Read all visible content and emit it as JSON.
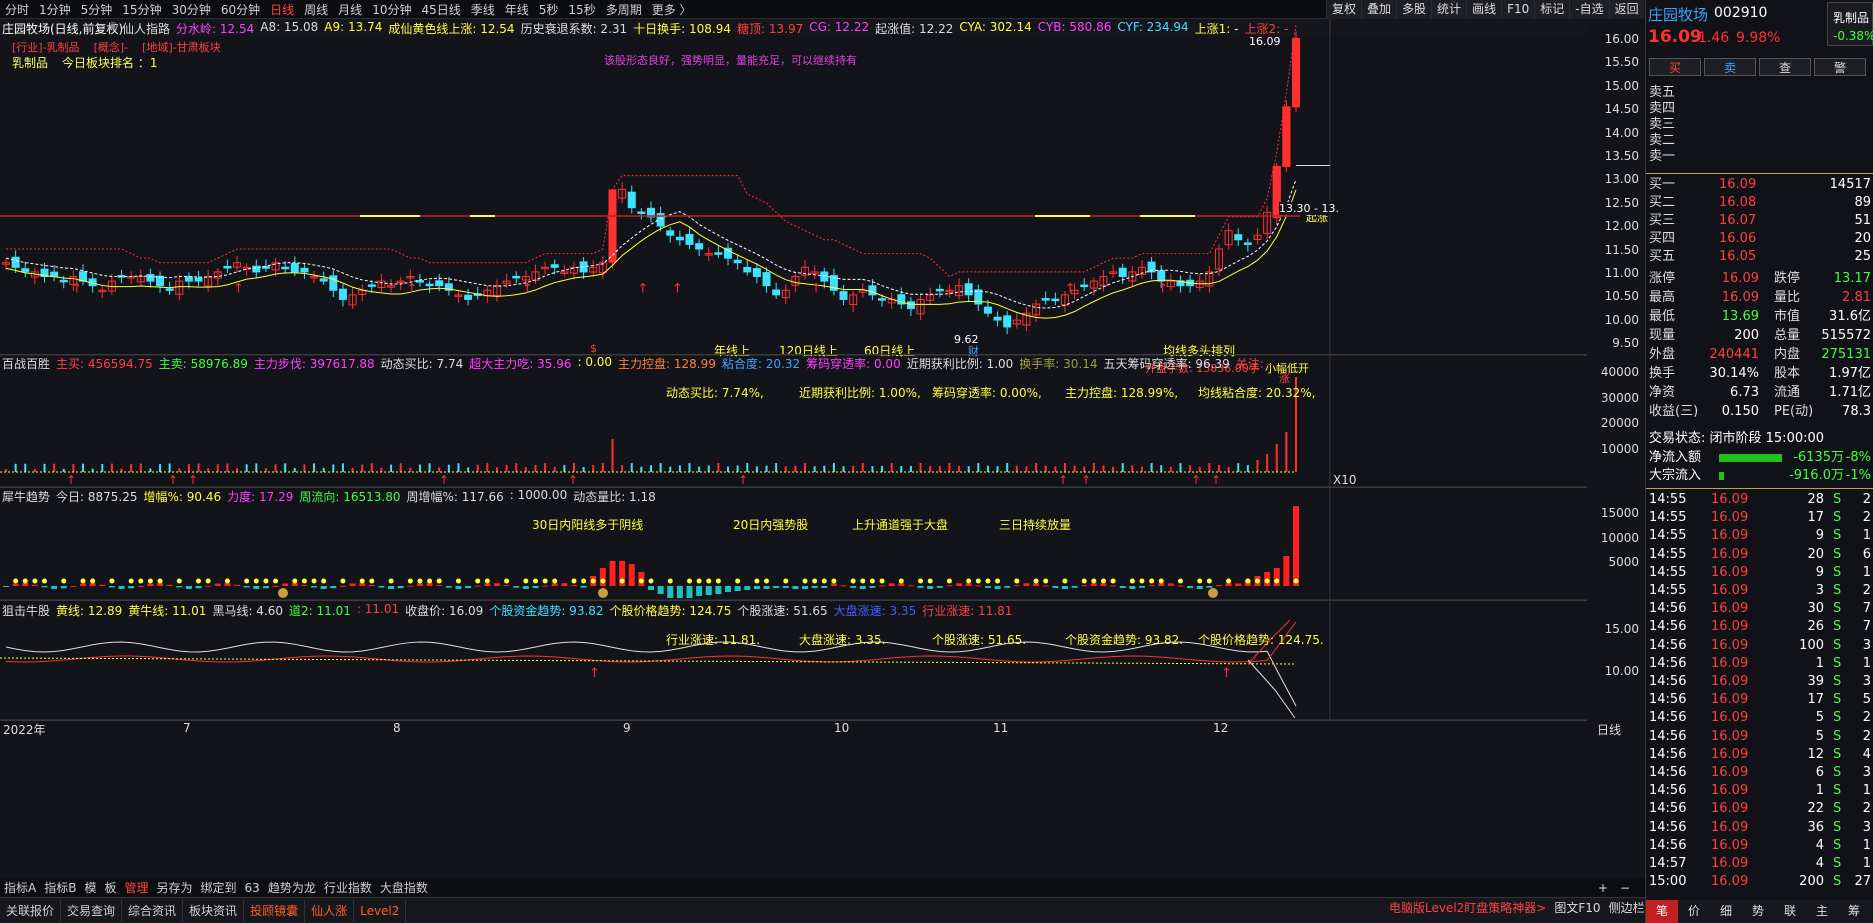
{
  "timeframes": [
    "分时",
    "1分钟",
    "5分钟",
    "15分钟",
    "30分钟",
    "60分钟",
    "日线",
    "周线",
    "月线",
    "10分钟",
    "45日线",
    "季线",
    "年线",
    "5秒",
    "15秒",
    "多周期",
    "更多 〉"
  ],
  "active_timeframe": "日线",
  "right_buttons": [
    "复权",
    "叠加",
    "多股",
    "统计",
    "画线",
    "F10",
    "标记",
    "-自选",
    "返回"
  ],
  "stock": {
    "name": "庄园牧场",
    "code": "002910",
    "price": "16.09",
    "change": "1.46",
    "pct": "9.98%",
    "sector": "乳制品",
    "sector_pct": "-0.38%"
  },
  "trade_buttons": [
    "买",
    "卖",
    "查",
    "警"
  ],
  "sell_levels": [
    "卖五",
    "卖四",
    "卖三",
    "卖二",
    "卖一"
  ],
  "buy_levels": [
    {
      "label": "买一",
      "price": "16.09",
      "vol": "14517"
    },
    {
      "label": "买二",
      "price": "16.08",
      "vol": "89"
    },
    {
      "label": "买三",
      "price": "16.07",
      "vol": "51"
    },
    {
      "label": "买四",
      "price": "16.06",
      "vol": "20"
    },
    {
      "label": "买五",
      "price": "16.05",
      "vol": "25"
    }
  ],
  "stats": [
    {
      "l1": "涨停",
      "v1": "16.09",
      "l2": "跌停",
      "v2": "13.17"
    },
    {
      "l1": "最高",
      "v1": "16.09",
      "l2": "量比",
      "v2": "2.81"
    },
    {
      "l1": "最低",
      "v1": "13.69",
      "l2": "市值",
      "v2": "31.6亿"
    },
    {
      "l1": "现量",
      "v1": "200",
      "l2": "总量",
      "v2": "515572"
    },
    {
      "l1": "外盘",
      "v1": "240441",
      "l2": "内盘",
      "v2": "275131"
    },
    {
      "l1": "换手",
      "v1": "30.14%",
      "l2": "股本",
      "v2": "1.97亿"
    },
    {
      "l1": "净资",
      "v1": "6.73",
      "l2": "流通",
      "v2": "1.71亿"
    },
    {
      "l1": "收益(三)",
      "v1": "0.150",
      "l2": "PE(动)",
      "v2": "78.3"
    }
  ],
  "trade_status": "交易状态: 闭市阶段 15:00:00",
  "flows": [
    {
      "label": "净流入额",
      "value": "-6135万",
      "pct": "-8%",
      "bar": 0.7
    },
    {
      "label": "大宗流入",
      "value": "-916.0万",
      "pct": "-1%",
      "bar": 0.05
    }
  ],
  "ticks": [
    [
      "14:55",
      "16.09",
      "28",
      "S",
      "2"
    ],
    [
      "14:55",
      "16.09",
      "17",
      "S",
      "2"
    ],
    [
      "14:55",
      "16.09",
      "9",
      "S",
      "1"
    ],
    [
      "14:55",
      "16.09",
      "20",
      "S",
      "6"
    ],
    [
      "14:55",
      "16.09",
      "9",
      "S",
      "1"
    ],
    [
      "14:55",
      "16.09",
      "3",
      "S",
      "2"
    ],
    [
      "14:56",
      "16.09",
      "30",
      "S",
      "7"
    ],
    [
      "14:56",
      "16.09",
      "26",
      "S",
      "7"
    ],
    [
      "14:56",
      "16.09",
      "100",
      "S",
      "3"
    ],
    [
      "14:56",
      "16.09",
      "1",
      "S",
      "1"
    ],
    [
      "14:56",
      "16.09",
      "39",
      "S",
      "3"
    ],
    [
      "14:56",
      "16.09",
      "17",
      "S",
      "5"
    ],
    [
      "14:56",
      "16.09",
      "5",
      "S",
      "2"
    ],
    [
      "14:56",
      "16.09",
      "5",
      "S",
      "2"
    ],
    [
      "14:56",
      "16.09",
      "12",
      "S",
      "4"
    ],
    [
      "14:56",
      "16.09",
      "6",
      "S",
      "3"
    ],
    [
      "14:56",
      "16.09",
      "1",
      "S",
      "1"
    ],
    [
      "14:56",
      "16.09",
      "22",
      "S",
      "2"
    ],
    [
      "14:56",
      "16.09",
      "36",
      "S",
      "3"
    ],
    [
      "14:56",
      "16.09",
      "4",
      "S",
      "1"
    ],
    [
      "14:57",
      "16.09",
      "4",
      "S",
      "1"
    ],
    [
      "15:00",
      "16.09",
      "200",
      "S",
      "27"
    ]
  ],
  "right_bottom_tabs": [
    "笔",
    "价",
    "细",
    "势",
    "联",
    "主",
    "筹"
  ],
  "main_chart": {
    "title": "庄园牧场(日线,前复权)",
    "indicator_line": [
      {
        "t": "仙人指路",
        "c": "#dddddd"
      },
      {
        "t": "分水岭: 12.54",
        "c": "#ff40ff"
      },
      {
        "t": "A8: 15.08",
        "c": "#dddddd"
      },
      {
        "t": "A9: 13.74",
        "c": "#ffff40"
      },
      {
        "t": "成仙黄色线上涨: 12.54",
        "c": "#ffff40"
      },
      {
        "t": "历史衰退系数: 2.31",
        "c": "#dddddd"
      },
      {
        "t": "十日换手: 108.94",
        "c": "#ffff40"
      },
      {
        "t": "糖顶: 13.97",
        "c": "#ff4040"
      },
      {
        "t": "CG: 12.22",
        "c": "#ff40ff"
      },
      {
        "t": "起涨值: 12.22",
        "c": "#dddddd"
      },
      {
        "t": "CYA: 302.14",
        "c": "#ffff40"
      },
      {
        "t": "CYB: 580.86",
        "c": "#ff40ff"
      },
      {
        "t": "CYF: 234.94",
        "c": "#40e0ff"
      },
      {
        "t": "上涨1: -",
        "c": "#ffff40"
      },
      {
        "t": "上涨2: -",
        "c": "#ff4040"
      }
    ],
    "tags": [
      "[行业]-乳制品",
      "[概念]-",
      "[地域]-甘肃板块"
    ],
    "sector_name": "乳制品",
    "sector_rank": "今日板块排名 ：1",
    "comment": "该股形态良好，强势明显，量能充足，可以继续持有",
    "annotations": [
      "年线上",
      "120日线上",
      "60日线上",
      "均线多头排列",
      "开盘手数: 15836.00手",
      "小幅低开",
      "起涨",
      "13.30 - 13.",
      "16.09",
      "9.62",
      "财",
      "涨",
      "$"
    ],
    "y_ticks": [
      "16.00",
      "15.50",
      "15.00",
      "14.50",
      "14.00",
      "13.50",
      "13.00",
      "12.50",
      "12.00",
      "11.50",
      "11.00",
      "10.50",
      "10.00",
      "9.50"
    ]
  },
  "panel2": {
    "labels": [
      {
        "t": "百战百胜",
        "c": "#dddddd"
      },
      {
        "t": "主买: 456594.75",
        "c": "#ff4040"
      },
      {
        "t": "主卖: 58976.89",
        "c": "#40ff40"
      },
      {
        "t": "主力步伐: 397617.88",
        "c": "#ff40ff"
      },
      {
        "t": "动态买比: 7.74",
        "c": "#dddddd"
      },
      {
        "t": "超大主力吃: 35.96",
        "c": "#ff40ff"
      },
      {
        "t": ": 0.00",
        "c": "#ffff40"
      },
      {
        "t": "主力控盘: 128.99",
        "c": "#ff8040"
      },
      {
        "t": "粘合度: 20.32",
        "c": "#40a0ff"
      },
      {
        "t": "筹码穿透率: 0.00",
        "c": "#ff40ff"
      },
      {
        "t": "近期获利比例: 1.00",
        "c": "#dddddd"
      },
      {
        "t": "换手率: 30.14",
        "c": "#a0a040"
      },
      {
        "t": "五天筹码穿透率: 96.39",
        "c": "#dddddd"
      },
      {
        "t": "关注: -",
        "c": "#ff4040"
      }
    ],
    "notes": [
      "动态买比: 7.74%,",
      "近期获利比例: 1.00%,",
      "筹码穿透率: 0.00%,",
      "主力控盘: 128.99%,",
      "均线粘合度: 20.32%,"
    ],
    "y_ticks": [
      "40000",
      "30000",
      "20000",
      "10000"
    ],
    "unit": "X10"
  },
  "panel3": {
    "labels": [
      {
        "t": "犀牛趋势",
        "c": "#dddddd"
      },
      {
        "t": "今日: 8875.25",
        "c": "#dddddd"
      },
      {
        "t": "增幅%: 90.46",
        "c": "#ffff40"
      },
      {
        "t": "力度: 17.29",
        "c": "#ff40ff"
      },
      {
        "t": "周流向: 16513.80",
        "c": "#40ff40"
      },
      {
        "t": "周增幅%: 117.66",
        "c": "#dddddd"
      },
      {
        "t": ": 1000.00",
        "c": "#dddddd"
      },
      {
        "t": "动态量比: 1.18",
        "c": "#dddddd"
      }
    ],
    "notes": [
      "30日内阳线多于阴线",
      "20日内强势股",
      "上升通道强于大盘",
      "三日持续放量"
    ],
    "y_ticks": [
      "15000",
      "10000",
      "5000"
    ]
  },
  "panel4": {
    "labels": [
      {
        "t": "狙击牛股",
        "c": "#dddddd"
      },
      {
        "t": "黄线: 12.89",
        "c": "#ffff40"
      },
      {
        "t": "黄牛线: 11.01",
        "c": "#ffff40"
      },
      {
        "t": "黑马线: 4.60",
        "c": "#dddddd"
      },
      {
        "t": "道2: 11.01",
        "c": "#40ff40"
      },
      {
        "t": ": 11.01",
        "c": "#ff4040"
      },
      {
        "t": "收盘价: 16.09",
        "c": "#dddddd"
      },
      {
        "t": "个股资金趋势: 93.82",
        "c": "#40e0ff"
      },
      {
        "t": "个股价格趋势: 124.75",
        "c": "#ffff40"
      },
      {
        "t": "个股涨速: 51.65",
        "c": "#dddddd"
      },
      {
        "t": "大盘涨速: 3.35",
        "c": "#4060ff"
      },
      {
        "t": "行业涨速: 11.81",
        "c": "#ff4040"
      }
    ],
    "notes": [
      "行业涨速: 11.81.",
      "大盘涨速: 3.35.",
      "个股涨速: 51.65.",
      "个股资金趋势: 93.82.",
      "个股价格趋势: 124.75."
    ],
    "y_ticks": [
      "15.00",
      "10.00"
    ]
  },
  "x_axis": [
    "2022年",
    "7",
    "8",
    "9",
    "10",
    "11",
    "12"
  ],
  "x_axis_period": "日线",
  "bottom_tabs": [
    "指标A",
    "指标B",
    "模",
    "板",
    "管理",
    "另存为",
    "绑定到",
    "63",
    "趋势为龙",
    "行业指数",
    "大盘指数"
  ],
  "bottom_bar": [
    "关联报价",
    "交易查询",
    "综合资讯",
    "板块资讯",
    "投顾镜囊",
    "仙人涨",
    "Level2"
  ],
  "bottom_right": [
    "电脑版Level2盯盘策略神器>",
    "图文F10",
    "侧边栏"
  ]
}
